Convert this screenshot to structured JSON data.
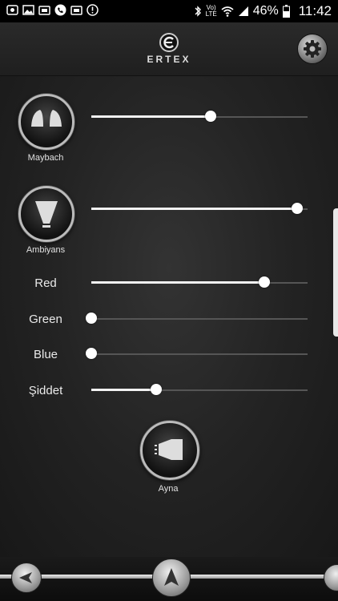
{
  "status_bar": {
    "battery_percent": "46%",
    "time": "11:42",
    "network_label": "LTE",
    "icons": [
      "gallery-icon",
      "image-icon",
      "cast-icon",
      "phone-icon",
      "cast-icon",
      "alert-icon",
      "bluetooth-icon",
      "volte-icon",
      "wifi-icon",
      "signal-icon",
      "battery-icon"
    ]
  },
  "header": {
    "brand": "ERTEX",
    "settings_icon": "gear-icon"
  },
  "lights": {
    "maybach": {
      "label": "Maybach",
      "level": 0.55,
      "icon": "maybach-light-icon"
    },
    "ambiyans": {
      "label": "Ambiyans",
      "level": 0.95,
      "icon": "ambiyans-light-icon"
    }
  },
  "color_sliders": [
    {
      "label": "Red",
      "level": 0.8
    },
    {
      "label": "Green",
      "level": 0.0
    },
    {
      "label": "Blue",
      "level": 0.0
    },
    {
      "label": "Şiddet",
      "level": 0.3
    }
  ],
  "mirror": {
    "label": "Ayna",
    "icon": "mirror-light-icon"
  },
  "bottom_nav": {
    "back_icon": "back-arrow-icon",
    "up_icon": "up-arrow-icon"
  },
  "colors": {
    "accent": "#ffffff",
    "track": "#555555",
    "background": "#1a1a1a"
  }
}
